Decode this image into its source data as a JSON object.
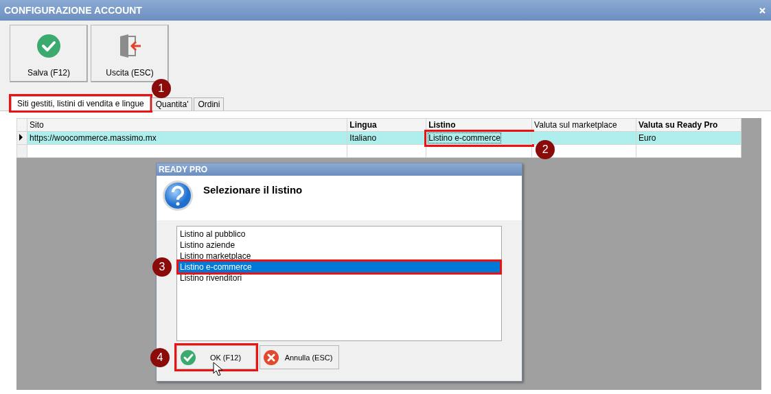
{
  "window": {
    "title": "CONFIGURAZIONE ACCOUNT"
  },
  "toolbar": [
    {
      "label": "Salva (F12)",
      "kind": "save"
    },
    {
      "label": "Uscita (ESC)",
      "kind": "exit"
    }
  ],
  "tabs": [
    {
      "label": "Siti gestiti, listini di vendita e lingue",
      "selected": true,
      "marker": "1"
    },
    {
      "label": "Quantita'",
      "selected": false
    },
    {
      "label": "Ordini",
      "selected": false
    }
  ],
  "table": {
    "columns": [
      {
        "label": "Sito",
        "bold": false
      },
      {
        "label": "Lingua",
        "bold": true
      },
      {
        "label": "Listino",
        "bold": true
      },
      {
        "label": "Valuta sul marketplace",
        "bold": false
      },
      {
        "label": "Valuta su Ready Pro",
        "bold": true
      }
    ],
    "rows": [
      {
        "current": true,
        "cells": [
          {
            "text": "https://woocommerce.massimo.mx"
          },
          {
            "text": "Italiano"
          },
          {
            "text": "Listino e-commerce",
            "focused": true,
            "marker": "2"
          },
          {},
          {
            "text": "Euro"
          }
        ]
      },
      {
        "current": false,
        "cells": [
          {},
          {},
          {},
          {},
          {}
        ]
      }
    ]
  },
  "dialog": {
    "title": "READY PRO",
    "heading": "Selezionare il listino",
    "options": [
      {
        "label": "Listino al pubblico",
        "selected": false
      },
      {
        "label": "Listino aziende",
        "selected": false
      },
      {
        "label": "Listino marketplace",
        "selected": false
      },
      {
        "label": "Listino e-commerce",
        "selected": true,
        "marker": "3"
      },
      {
        "label": "Listino rivenditori",
        "selected": false
      }
    ],
    "buttons": [
      {
        "label": "OK (F12)",
        "kind": "ok",
        "marker": "4"
      },
      {
        "label": "Annulla (ESC)",
        "kind": "cancel"
      }
    ]
  }
}
